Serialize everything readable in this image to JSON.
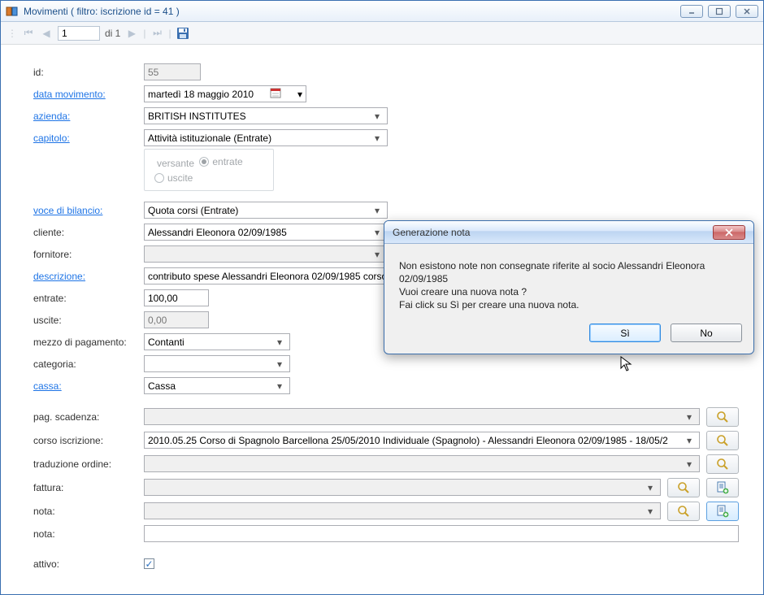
{
  "window": {
    "title": "Movimenti ( filtro: iscrizione id = 41 )"
  },
  "nav": {
    "pos": "1",
    "of_label": "di 1"
  },
  "form": {
    "id_label": "id:",
    "id": "55",
    "date_label": "data movimento:",
    "date": "martedì  18  maggio  2010",
    "azienda_label": "azienda:",
    "azienda": "BRITISH INSTITUTES",
    "capitolo_label": "capitolo:",
    "capitolo": "Attività istituzionale (Entrate)",
    "versante_label": "versante",
    "r_entrate": "entrate",
    "r_uscite": "uscite",
    "voce_label": "voce di bilancio:",
    "voce": "Quota corsi (Entrate)",
    "cliente_label": "cliente:",
    "cliente": "Alessandri Eleonora 02/09/1985",
    "fornitore_label": "fornitore:",
    "fornitore": "",
    "descr_label": "descrizione:",
    "descr": "contributo spese Alessandri Eleonora 02/09/1985 corso: 201",
    "entrate_label": "entrate:",
    "entrate": "100,00",
    "uscite_label": "uscite:",
    "uscite": "0,00",
    "mezzo_label": "mezzo di pagamento:",
    "mezzo": "Contanti",
    "categoria_label": "categoria:",
    "categoria": "",
    "cassa_label": "cassa:",
    "cassa": "Cassa",
    "pagscad_label": "pag. scadenza:",
    "pagscad": "",
    "corso_label": "corso iscrizione:",
    "corso": "2010.05.25 Corso di Spagnolo Barcellona 25/05/2010 Individuale (Spagnolo) -  Alessandri Eleonora 02/09/1985 - 18/05/2",
    "trad_label": "traduzione ordine:",
    "trad": "",
    "fattura_label": "fattura:",
    "fattura": "",
    "nota_label": "nota:",
    "nota": "",
    "nota2_label": "nota:",
    "nota2": "",
    "attivo_label": "attivo:"
  },
  "dialog": {
    "title": "Generazione nota",
    "line1": "Non esistono note non consegnate riferite al socio Alessandri Eleonora",
    "line2": "02/09/1985",
    "line3": "Vuoi creare una nuova nota ?",
    "line4": "Fai click su Sì per creare una nuova nota.",
    "yes": "Sì",
    "no": "No"
  }
}
